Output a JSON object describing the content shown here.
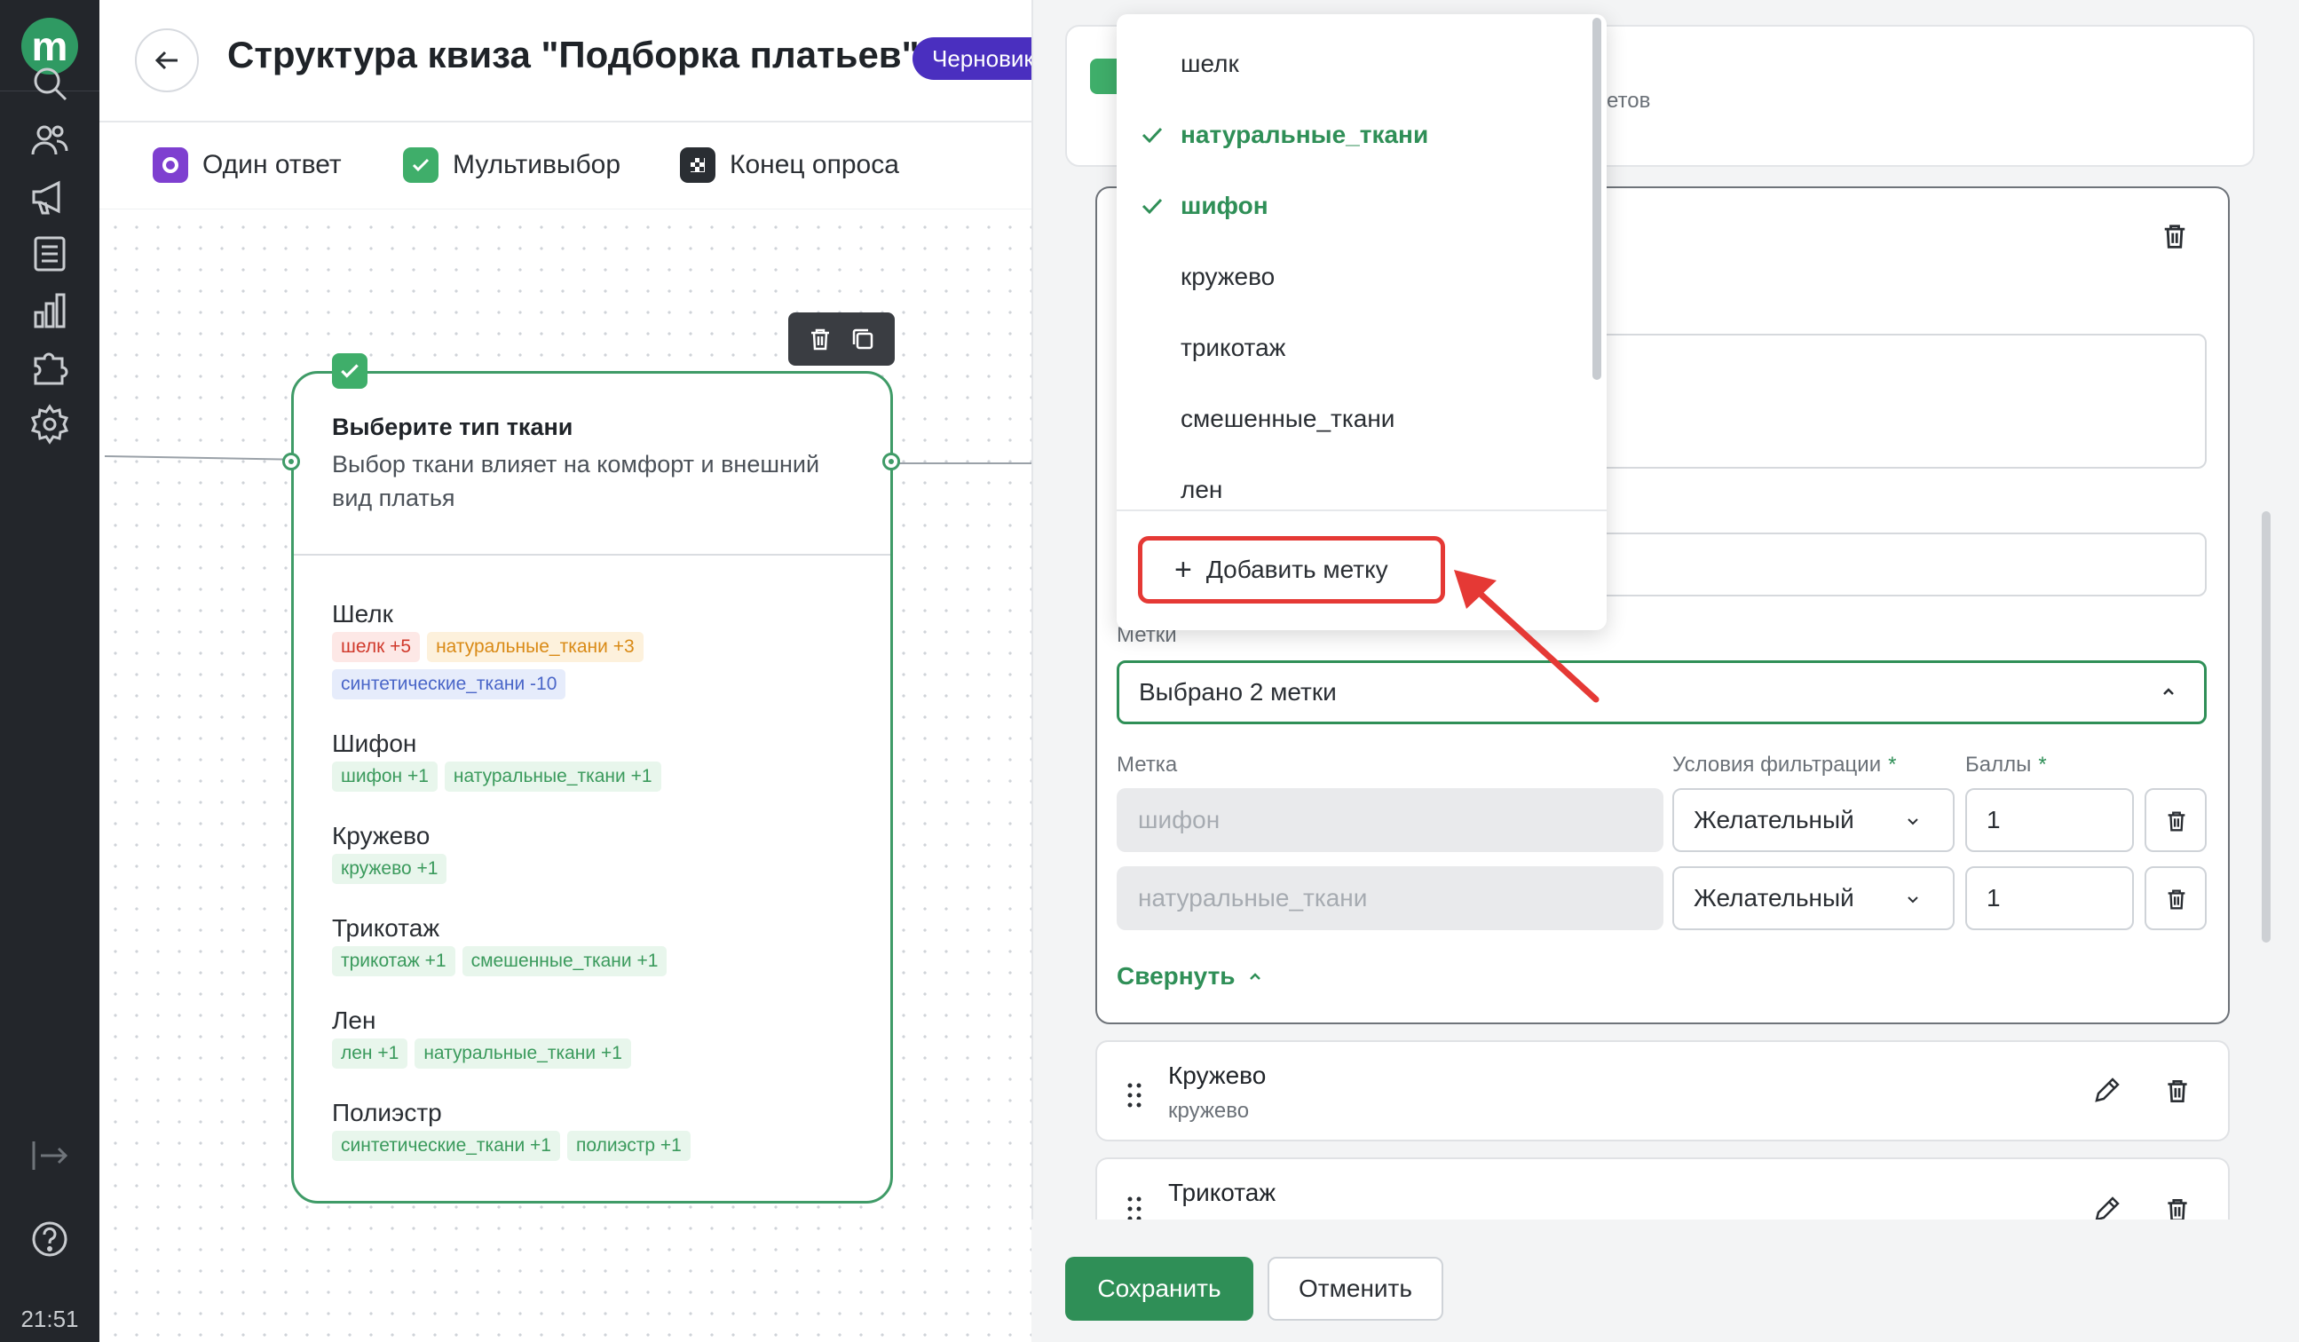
{
  "app": {
    "page_title": "Структура квиза \"Подборка платьев\"",
    "status_badge": "Черновик",
    "clock": "21:51"
  },
  "toolbar": {
    "single_answer": "Один ответ",
    "multi_select": "Мультивыбор",
    "end_survey": "Конец опроса"
  },
  "node": {
    "title": "Выберите тип ткани",
    "description": "Выбор ткани влияет на комфорт и внешний вид платья",
    "options": [
      {
        "name": "Шелк",
        "tags": [
          {
            "text": "шелк +5",
            "tone": "red"
          },
          {
            "text": "натуральные_ткани +3",
            "tone": "orange"
          },
          {
            "text": "синтетические_ткани -10",
            "tone": "blue"
          }
        ]
      },
      {
        "name": "Шифон",
        "tags": [
          {
            "text": "шифон +1",
            "tone": "green"
          },
          {
            "text": "натуральные_ткани +1",
            "tone": "green"
          }
        ]
      },
      {
        "name": "Кружево",
        "tags": [
          {
            "text": "кружево +1",
            "tone": "green"
          }
        ]
      },
      {
        "name": "Трикотаж",
        "tags": [
          {
            "text": "трикотаж +1",
            "tone": "green"
          },
          {
            "text": "смешенные_ткани +1",
            "tone": "green"
          }
        ]
      },
      {
        "name": "Лен",
        "tags": [
          {
            "text": "лен +1",
            "tone": "green"
          },
          {
            "text": "натуральные_ткани +1",
            "tone": "green"
          }
        ]
      },
      {
        "name": "Полиэстр",
        "tags": [
          {
            "text": "синтетические_ткани +1",
            "tone": "green"
          },
          {
            "text": "полиэстр +1",
            "tone": "green"
          }
        ]
      }
    ]
  },
  "panel": {
    "top_card_text": "етов",
    "tags_label": "Метки",
    "tags_select_value": "Выбрано 2 метки",
    "columns": {
      "tag": "Метка",
      "filter": "Условия фильтрации",
      "score": "Баллы",
      "required_mark": "*"
    },
    "rows": [
      {
        "tag": "шифон",
        "filter": "Желательный",
        "score": "1"
      },
      {
        "tag": "натуральные_ткани",
        "filter": "Желательный",
        "score": "1"
      }
    ],
    "collapse_label": "Свернуть",
    "answers": [
      {
        "name": "Кружево",
        "sub": "кружево"
      },
      {
        "name": "Трикотаж",
        "sub": ""
      }
    ],
    "save_label": "Сохранить",
    "cancel_label": "Отменить"
  },
  "dropdown": {
    "items": [
      {
        "label": "шелк",
        "selected": false
      },
      {
        "label": "натуральные_ткани",
        "selected": true
      },
      {
        "label": "шифон",
        "selected": true
      },
      {
        "label": "кружево",
        "selected": false
      },
      {
        "label": "трикотаж",
        "selected": false
      },
      {
        "label": "смешенные_ткани",
        "selected": false
      },
      {
        "label": "лен",
        "selected": false
      }
    ],
    "add_tag_label": "Добавить метку"
  },
  "colors": {
    "accent_green": "#2f8f57",
    "badge_purple": "#4a2fbf",
    "highlight_red": "#e53935",
    "rail_dark": "#23262b"
  },
  "icons": {
    "rail": [
      "search-icon",
      "users-icon",
      "megaphone-icon",
      "list-icon",
      "chart-icon",
      "puzzle-icon",
      "gear-icon",
      "logout-icon",
      "help-icon"
    ]
  }
}
